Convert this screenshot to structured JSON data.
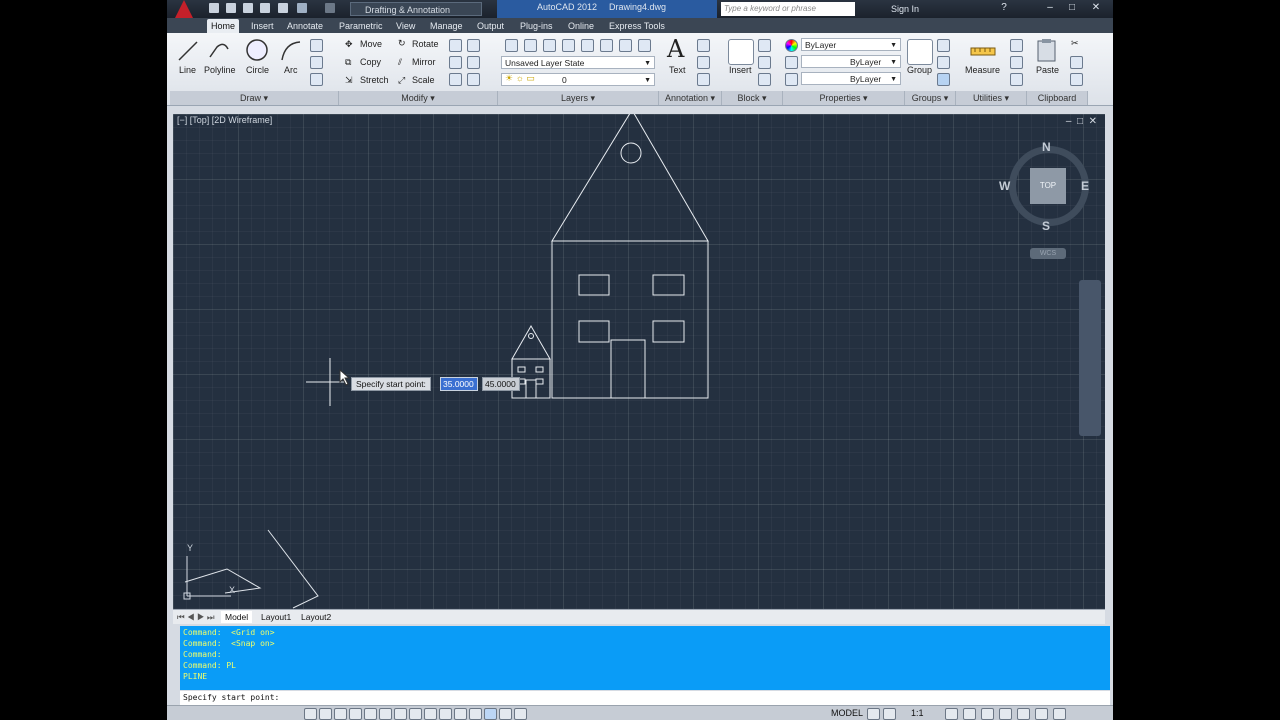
{
  "app": {
    "workspace": "Drafting & Annotation",
    "app_name": "AutoCAD 2012",
    "document": "Drawing4.dwg",
    "search_placeholder": "Type a keyword or phrase",
    "sign_in": "Sign In"
  },
  "tabs": [
    "Home",
    "Insert",
    "Annotate",
    "Parametric",
    "View",
    "Manage",
    "Output",
    "Plug-ins",
    "Online",
    "Express Tools"
  ],
  "ribbon": {
    "draw": {
      "line": "Line",
      "polyline": "Polyline",
      "circle": "Circle",
      "arc": "Arc"
    },
    "modify": {
      "move": "Move",
      "rotate": "Rotate",
      "copy": "Copy",
      "mirror": "Mirror",
      "stretch": "Stretch",
      "scale": "Scale"
    },
    "layers": {
      "layer_state": "Unsaved Layer State",
      "current_layer": "0"
    },
    "annotation": {
      "text": "Text"
    },
    "block": {
      "insert": "Insert"
    },
    "properties": {
      "color": "ByLayer",
      "linetype": "ByLayer",
      "lineweight": "ByLayer"
    },
    "groups": {
      "group": "Group"
    },
    "utilities": {
      "measure": "Measure"
    },
    "clipboard": {
      "paste": "Paste"
    },
    "panels": [
      "Draw",
      "Modify",
      "Layers",
      "Annotation",
      "Block",
      "Properties",
      "Groups",
      "Utilities",
      "Clipboard"
    ]
  },
  "viewport": {
    "label": "[−] [Top] [2D Wireframe]",
    "viewcube_top": "TOP",
    "compass": {
      "n": "N",
      "s": "S",
      "e": "E",
      "w": "W"
    },
    "wcs": "WCS",
    "ucs_y": "Y",
    "ucs_x": "X"
  },
  "dynamic_input": {
    "prompt": "Specify start point:",
    "x_value": "35.0000",
    "y_value": "45.0000"
  },
  "layout_tabs": [
    "Model",
    "Layout1",
    "Layout2"
  ],
  "command_history": [
    "Command:  <Grid on>",
    "Command:  <Snap on>",
    "Command:",
    "Command: PL",
    "PLINE"
  ],
  "command_line": "Specify start point:",
  "status": {
    "model": "MODEL",
    "scale": "1:1"
  },
  "colors": {
    "canvas": "#243040",
    "command_bg": "#0a9cf7",
    "command_text": "#f0ff6a",
    "accent": "#2a5ba0"
  }
}
